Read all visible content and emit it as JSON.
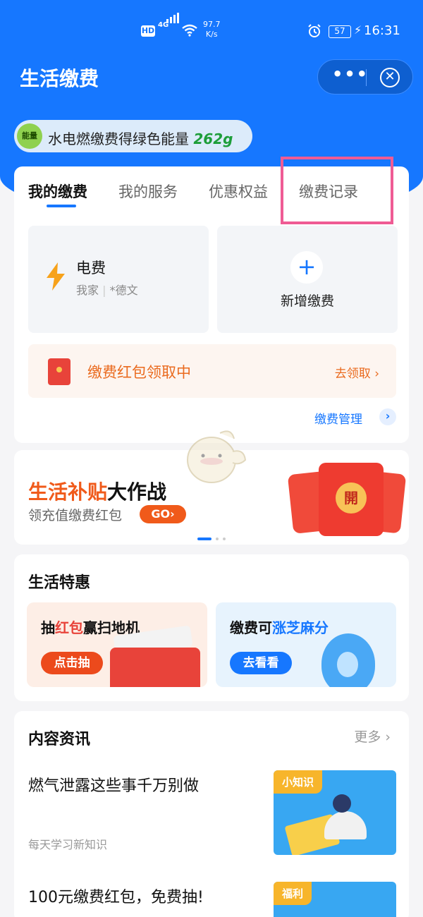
{
  "status_bar": {
    "hd": "HD",
    "network": "4G",
    "speed_top": "97.7",
    "speed_bottom": "K/s",
    "battery": "57",
    "time": "16:31"
  },
  "header": {
    "title": "生活缴费",
    "more_icon": "more-dots-icon",
    "close_icon": "close-circle-icon"
  },
  "energy": {
    "badge": "能量",
    "text": "水电燃缴费得绿色能量",
    "amount": "262g"
  },
  "tabs": [
    {
      "label": "我的缴费",
      "active": true
    },
    {
      "label": "我的服务",
      "active": false
    },
    {
      "label": "优惠权益",
      "active": false
    },
    {
      "label": "缴费记录",
      "active": false
    }
  ],
  "bills": {
    "electric": {
      "title": "电费",
      "account": "我家",
      "separator": "|",
      "owner": "*德文"
    },
    "add": {
      "label": "新增缴费",
      "icon": "+"
    }
  },
  "red_packet": {
    "text": "缴费红包领取中",
    "link": "去领取"
  },
  "manage": {
    "label": "缴费管理",
    "arrow": "›"
  },
  "banner": {
    "title_highlight": "生活补贴",
    "title_rest": "大作战",
    "subtitle": "领充值缴费红包",
    "go": "GO›",
    "seal": "開"
  },
  "specials": {
    "title": "生活特惠",
    "promo_a": {
      "prefix": "抽",
      "highlight": "红包",
      "suffix": "赢扫地机",
      "button": "点击抽"
    },
    "promo_b": {
      "prefix": "缴费可",
      "highlight": "涨芝麻分",
      "button": "去看看"
    }
  },
  "news": {
    "title": "内容资讯",
    "more": "更多 ›",
    "items": [
      {
        "title": "燃气泄露这些事千万别做",
        "subtitle": "每天学习新知识",
        "tag": "小知识"
      },
      {
        "title": "100元缴费红包，免费抽!",
        "tag": "福利"
      }
    ]
  },
  "colors": {
    "primary": "#1677ff",
    "accent_orange": "#f05a1a",
    "highlight_pink": "#ef5b94",
    "energy_green": "#1e9e3a"
  }
}
